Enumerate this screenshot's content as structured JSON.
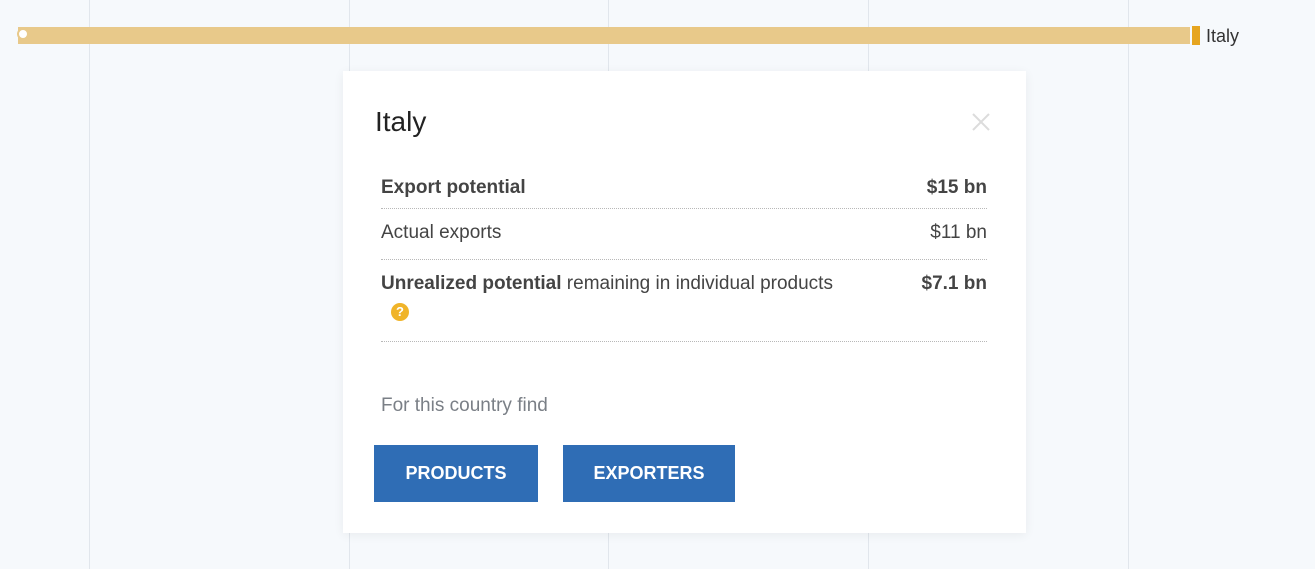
{
  "bar": {
    "label": "Italy",
    "colors": {
      "bar": "#e8c98a",
      "marker": "#e6a520"
    }
  },
  "popup": {
    "title": "Italy",
    "rows": [
      {
        "label_bold": "Export potential",
        "label_rest": "",
        "value": "$15 bn",
        "value_bold": true
      },
      {
        "label_bold": "",
        "label_rest": "Actual exports",
        "value": "$11 bn",
        "value_bold": false
      },
      {
        "label_bold": "Unrealized potential",
        "label_rest": " remaining in individual products",
        "value": "$7.1 bn",
        "value_bold": true,
        "help_icon": "?"
      }
    ],
    "find_text": "For this country find",
    "buttons": {
      "products": "PRODUCTS",
      "exporters": "EXPORTERS"
    },
    "colors": {
      "button": "#2f6db5",
      "help": "#f0b429"
    }
  }
}
